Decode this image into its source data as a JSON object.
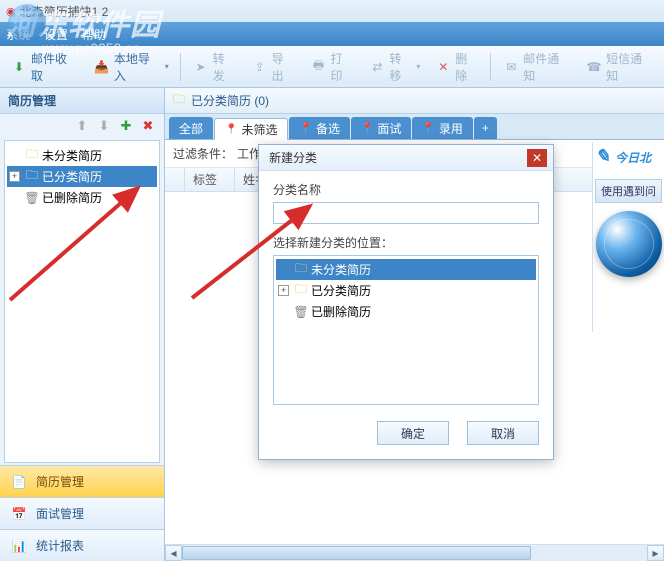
{
  "window": {
    "title": "北森简历捕快1.2"
  },
  "menubar": {
    "items": [
      "系统",
      "设置",
      "帮助"
    ]
  },
  "watermark": {
    "text": "河东软件园",
    "url": "www.pc0359.cn"
  },
  "toolbar": {
    "mail_receive": "邮件收取",
    "local_import": "本地导入",
    "forward": "转发",
    "export": "导出",
    "print": "打印",
    "transfer": "转移",
    "delete": "删除",
    "mail_notify": "邮件通知",
    "sms_notify": "短信通知"
  },
  "sidebar": {
    "title": "简历管理",
    "tree": [
      {
        "label": "未分类简历",
        "icon": "folder"
      },
      {
        "label": "已分类简历",
        "icon": "folder",
        "selected": true,
        "expandable": true
      },
      {
        "label": "已删除简历",
        "icon": "trash"
      }
    ],
    "nav": [
      {
        "label": "简历管理",
        "active": true
      },
      {
        "label": "面试管理"
      },
      {
        "label": "统计报表"
      }
    ]
  },
  "content": {
    "header": "已分类简历 (0)",
    "tabs": [
      {
        "label": "全部"
      },
      {
        "label": "未筛选",
        "active": true,
        "pin": "red"
      },
      {
        "label": "备选",
        "pin": "blue"
      },
      {
        "label": "面试",
        "pin": "yellow"
      },
      {
        "label": "录用",
        "pin": "green"
      },
      {
        "label": "+"
      }
    ],
    "filter_label": "过滤条件：",
    "filter_value": "工作经",
    "columns": [
      "标签",
      "姓名"
    ]
  },
  "right_panel": {
    "title": "今日北",
    "button": "使用遇到问"
  },
  "dialog": {
    "title": "新建分类",
    "name_label": "分类名称",
    "name_value": "",
    "name_placeholder": "",
    "pos_label": "选择新建分类的位置：",
    "tree": [
      {
        "label": "未分类简历",
        "icon": "folder",
        "selected": true
      },
      {
        "label": "已分类简历",
        "icon": "folder",
        "expandable": true
      },
      {
        "label": "已删除简历",
        "icon": "trash"
      }
    ],
    "ok": "确定",
    "cancel": "取消"
  }
}
